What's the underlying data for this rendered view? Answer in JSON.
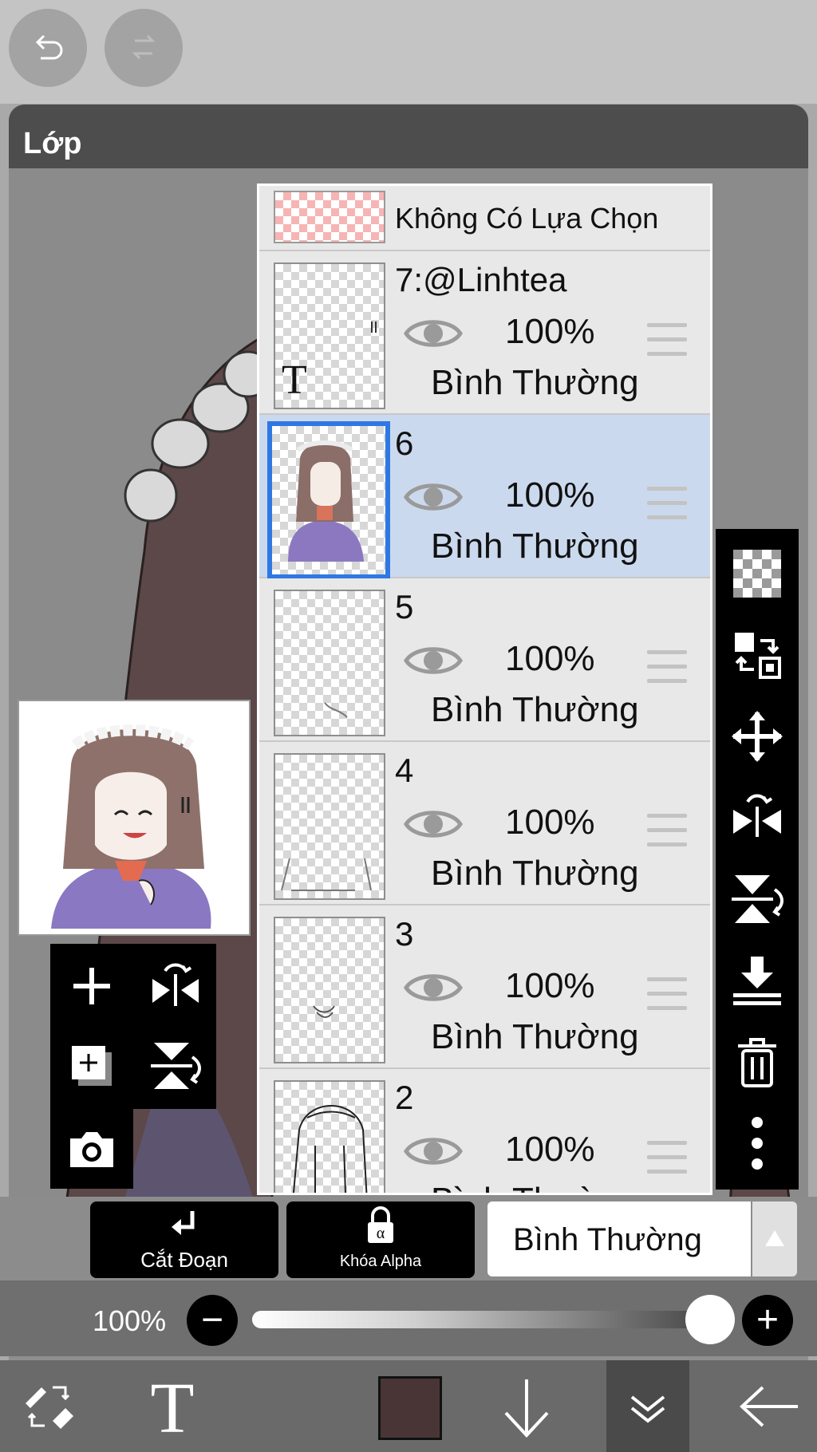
{
  "panel": {
    "title": "Lớp"
  },
  "layers_panel": {
    "selection_layer": {
      "label": "Không Có Lựa Chọn"
    },
    "layers": [
      {
        "name": "7:@Linhtea",
        "opacity": "100%",
        "blend_mode": "Bình Thường",
        "type": "text",
        "selected": false
      },
      {
        "name": "6",
        "opacity": "100%",
        "blend_mode": "Bình Thường",
        "type": "raster",
        "selected": true
      },
      {
        "name": "5",
        "opacity": "100%",
        "blend_mode": "Bình Thường",
        "type": "raster",
        "selected": false
      },
      {
        "name": "4",
        "opacity": "100%",
        "blend_mode": "Bình Thường",
        "type": "raster",
        "selected": false
      },
      {
        "name": "3",
        "opacity": "100%",
        "blend_mode": "Bình Thường",
        "type": "raster",
        "selected": false
      },
      {
        "name": "2",
        "opacity": "100%",
        "blend_mode": "Bình Thường",
        "type": "raster",
        "selected": false
      }
    ]
  },
  "layer_controls": {
    "clipping_label": "Cắt Đoạn",
    "alpha_lock_label": "Khóa Alpha",
    "blend_mode_value": "Bình Thường"
  },
  "opacity_control": {
    "label": "100%",
    "value": 1.0
  },
  "bottom_nav": {
    "current_color": "#4a3536"
  },
  "colors": {
    "selected_row": "#cbd9ee",
    "selected_border": "#2f78e3"
  }
}
